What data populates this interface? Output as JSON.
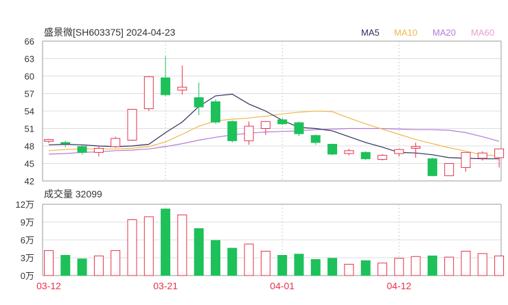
{
  "chart_data": {
    "type": "candlestick",
    "title": "盛景微[SH603375] 2024-04-23",
    "colors": {
      "up": "#e8304a",
      "down": "#1ec05a",
      "ma5": "#2b2e5a",
      "ma10": "#f2b64a",
      "ma20": "#b27bd8",
      "ma60": "#e9a0cf",
      "grid": "#bbbbbb"
    },
    "legend": [
      {
        "name": "MA5",
        "color": "#2b2e5a"
      },
      {
        "name": "MA10",
        "color": "#f2b64a"
      },
      {
        "name": "MA20",
        "color": "#b27bd8"
      },
      {
        "name": "MA60",
        "color": "#e9a0cf"
      }
    ],
    "price_axis": {
      "ticks": [
        "66",
        "63",
        "60",
        "57",
        "54",
        "51",
        "48",
        "45",
        "42"
      ],
      "ylim": [
        42,
        66
      ]
    },
    "date_labels": [
      {
        "index": 0,
        "label": "03-12"
      },
      {
        "index": 7,
        "label": "03-21"
      },
      {
        "index": 14,
        "label": "04-01"
      },
      {
        "index": 21,
        "label": "04-12"
      }
    ],
    "candles": [
      {
        "o": 48.8,
        "c": 49.1,
        "h": 49.2,
        "l": 48.5
      },
      {
        "o": 48.6,
        "c": 48.4,
        "h": 48.9,
        "l": 47.8
      },
      {
        "o": 47.9,
        "c": 46.9,
        "h": 48.1,
        "l": 46.5
      },
      {
        "o": 46.9,
        "c": 47.6,
        "h": 48.0,
        "l": 46.2
      },
      {
        "o": 47.9,
        "c": 49.3,
        "h": 49.6,
        "l": 47.7
      },
      {
        "o": 49.0,
        "c": 54.3,
        "h": 54.3,
        "l": 48.9
      },
      {
        "o": 54.4,
        "c": 59.9,
        "h": 60.0,
        "l": 54.0
      },
      {
        "o": 59.7,
        "c": 56.8,
        "h": 63.4,
        "l": 56.6
      },
      {
        "o": 57.6,
        "c": 58.1,
        "h": 61.8,
        "l": 56.8
      },
      {
        "o": 56.3,
        "c": 54.7,
        "h": 58.9,
        "l": 53.3
      },
      {
        "o": 55.6,
        "c": 52.1,
        "h": 56.0,
        "l": 51.8
      },
      {
        "o": 52.2,
        "c": 48.9,
        "h": 52.4,
        "l": 48.6
      },
      {
        "o": 48.9,
        "c": 51.4,
        "h": 52.2,
        "l": 48.2
      },
      {
        "o": 51.0,
        "c": 52.2,
        "h": 52.3,
        "l": 49.9
      },
      {
        "o": 52.5,
        "c": 51.8,
        "h": 52.8,
        "l": 51.6
      },
      {
        "o": 52.0,
        "c": 50.1,
        "h": 52.2,
        "l": 49.7
      },
      {
        "o": 49.8,
        "c": 48.6,
        "h": 50.0,
        "l": 48.2
      },
      {
        "o": 48.3,
        "c": 46.6,
        "h": 48.4,
        "l": 46.4
      },
      {
        "o": 46.7,
        "c": 47.2,
        "h": 47.5,
        "l": 46.4
      },
      {
        "o": 46.9,
        "c": 45.8,
        "h": 47.1,
        "l": 45.6
      },
      {
        "o": 45.7,
        "c": 46.4,
        "h": 46.6,
        "l": 45.5
      },
      {
        "o": 46.7,
        "c": 47.4,
        "h": 47.5,
        "l": 46.2
      },
      {
        "o": 47.6,
        "c": 47.9,
        "h": 48.6,
        "l": 46.0
      },
      {
        "o": 45.8,
        "c": 42.9,
        "h": 46.0,
        "l": 42.8
      },
      {
        "o": 42.9,
        "c": 45.0,
        "h": 45.0,
        "l": 42.9
      },
      {
        "o": 44.3,
        "c": 46.9,
        "h": 46.9,
        "l": 43.6
      },
      {
        "o": 45.9,
        "c": 46.8,
        "h": 47.1,
        "l": 45.5
      },
      {
        "o": 46.0,
        "c": 47.5,
        "h": 47.5,
        "l": 44.3
      }
    ],
    "ma5": [
      48.2,
      48.3,
      48.2,
      48.0,
      47.9,
      48.0,
      48.3,
      50.3,
      52.1,
      54.8,
      56.6,
      56.9,
      55.2,
      54.0,
      52.4,
      51.2,
      51.0,
      50.6,
      49.6,
      48.6,
      47.8,
      46.9,
      46.8,
      46.5,
      46.0,
      45.9,
      45.8,
      45.8
    ],
    "ma10": [
      47.2,
      47.4,
      47.5,
      47.5,
      47.5,
      47.6,
      47.9,
      48.7,
      50.0,
      51.4,
      52.3,
      52.6,
      52.8,
      53.1,
      53.5,
      53.8,
      54.0,
      53.9,
      52.8,
      51.8,
      50.9,
      50.0,
      49.1,
      48.4,
      47.7,
      47.1,
      46.5,
      46.3
    ],
    "ma20": [
      46.6,
      46.7,
      46.9,
      47.0,
      47.2,
      47.3,
      47.5,
      47.9,
      48.4,
      49.0,
      49.5,
      49.9,
      50.2,
      50.4,
      50.5,
      50.6,
      50.8,
      50.9,
      51.0,
      51.0,
      51.0,
      50.9,
      50.8,
      50.8,
      50.7,
      50.3,
      49.6,
      48.8
    ],
    "volume": {
      "label": "成交量 32099",
      "ticks": [
        "12万",
        "9万",
        "6万",
        "3万",
        "0万"
      ],
      "ylim": [
        0,
        12
      ],
      "values": [
        4.2,
        3.4,
        2.8,
        3.3,
        4.2,
        9.4,
        9.9,
        11.2,
        10.2,
        7.9,
        5.9,
        4.6,
        5.3,
        4.1,
        3.4,
        3.6,
        2.7,
        2.9,
        1.9,
        2.5,
        2.1,
        2.9,
        3.2,
        3.3,
        3.1,
        4.1,
        3.7,
        3.3
      ]
    }
  }
}
